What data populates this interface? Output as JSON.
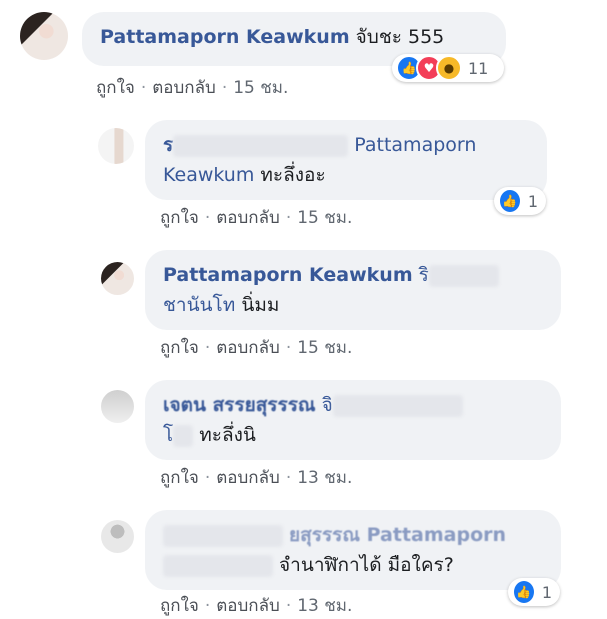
{
  "comments": [
    {
      "name": "Pattamaporn Keawkum",
      "text": "จับชะ 555",
      "like": "ถูกใจ",
      "reply": "ตอบกลับ",
      "time": "15 ชม.",
      "reaction_count": "11",
      "reactions": [
        "like-icon",
        "love-icon",
        "wow-icon"
      ]
    },
    {
      "name_prefix": "ร",
      "tag1": "Pattamaporn",
      "tag2": "Keawkum",
      "text": "ทะลึ่งอะ",
      "like": "ถูกใจ",
      "reply": "ตอบกลับ",
      "time": "15 ชม.",
      "reaction_count": "1"
    },
    {
      "name": "Pattamaporn Keawkum",
      "tag_start": "ริ",
      "tag_end": "ชานันโท",
      "text": "นิ่มม",
      "like": "ถูกใจ",
      "reply": "ตอบกลับ",
      "time": "15 ชม."
    },
    {
      "name_partial": "เจตน สรรยสุรรรณ",
      "tag_start": "จิ",
      "tag_first_line_end": "โ",
      "text": "ทะลึ่งนิ",
      "like": "ถูกใจ",
      "reply": "ตอบกลับ",
      "time": "13 ชม."
    },
    {
      "name_partial": "ยสุรรรณ Pattamaporn",
      "text": "จำนาฬิกาได้ มือใคร?",
      "like": "ถูกใจ",
      "reply": "ตอบกลับ",
      "time": "13 ชม.",
      "reaction_count": "1"
    }
  ]
}
